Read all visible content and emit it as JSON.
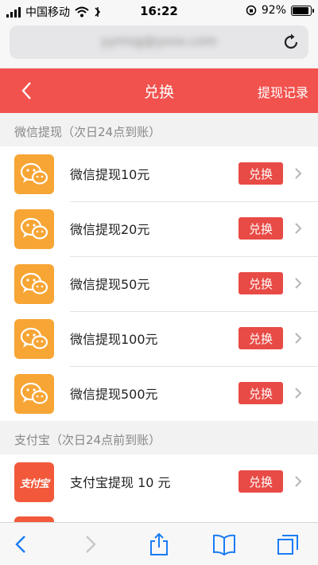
{
  "status_bar": {
    "carrier": "中国移动",
    "time": "16:22",
    "battery": "92%",
    "battery_level": 0.92
  },
  "address_bar": {
    "url": "yymsg@yxxx.com"
  },
  "header": {
    "title": "兑换",
    "right_link": "提现记录"
  },
  "wechat_section": {
    "title": "微信提现（次日24点到账）",
    "items": [
      {
        "label": "微信提现10元",
        "button": "兑换"
      },
      {
        "label": "微信提现20元",
        "button": "兑换"
      },
      {
        "label": "微信提现50元",
        "button": "兑换"
      },
      {
        "label": "微信提现100元",
        "button": "兑换"
      },
      {
        "label": "微信提现500元",
        "button": "兑换"
      }
    ]
  },
  "alipay_section": {
    "title": "支付宝（次日24点前到账）",
    "items": [
      {
        "icon_text": "支付宝",
        "label": "支付宝提现 10 元",
        "button": "兑换"
      }
    ]
  },
  "colors": {
    "header": "#f1524e",
    "button": "#e84a45",
    "wechat_icon": "#f7a534",
    "alipay_icon": "#f2593b",
    "toolbar_icon": "#1a7cf5"
  },
  "icons": {
    "back": "chevron-left-icon",
    "forward": "chevron-right-icon",
    "share": "share-icon",
    "bookmarks": "book-icon",
    "tabs": "tabs-icon",
    "reload": "reload-icon",
    "wechat": "wechat-icon",
    "row_arrow": "chevron-right-icon"
  }
}
